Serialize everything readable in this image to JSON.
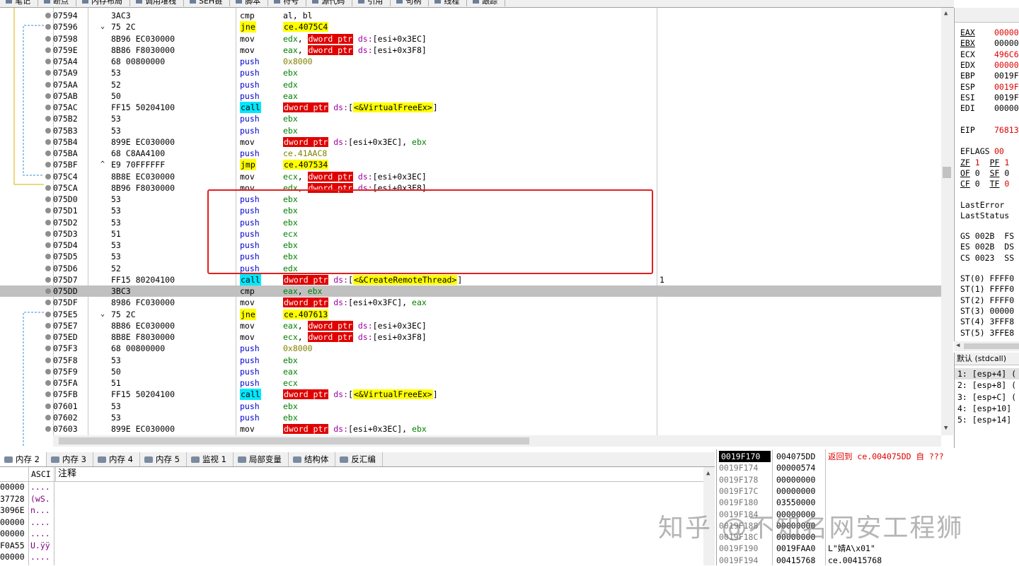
{
  "top_tabs": [
    "笔记",
    "断点",
    "内存布局",
    "调用堆栈",
    "SEH链",
    "脚本",
    "符号",
    "源代码",
    "引用",
    "句柄",
    "线程",
    "跟踪"
  ],
  "disasm": {
    "rows": [
      {
        "addr": "07594",
        "jm": "",
        "bytes": "3AC3",
        "mn": "cmp",
        "kind": "plain",
        "ops": [
          {
            "t": "al, bl",
            "k": "txt"
          }
        ],
        "cmt": ""
      },
      {
        "addr": "07596",
        "jm": "⌄",
        "bytes": "75 2C",
        "mn": "jne",
        "kind": "jmp",
        "ops": [
          {
            "t": "ce.4075C4",
            "k": "lbl"
          }
        ],
        "cmt": ""
      },
      {
        "addr": "07598",
        "jm": "",
        "bytes": "8B96 EC030000",
        "mn": "mov",
        "kind": "plain",
        "ops": [
          {
            "t": "edx",
            "k": "reg"
          },
          {
            "t": ", ",
            "k": "txt"
          },
          {
            "t": "dword ptr",
            "k": "ptr"
          },
          {
            "t": " ds:",
            "k": "seg"
          },
          {
            "t": "[esi+0x3EC]",
            "k": "txt"
          }
        ],
        "cmt": ""
      },
      {
        "addr": "0759E",
        "jm": "",
        "bytes": "8B86 F8030000",
        "mn": "mov",
        "kind": "plain",
        "ops": [
          {
            "t": "eax",
            "k": "reg"
          },
          {
            "t": ", ",
            "k": "txt"
          },
          {
            "t": "dword ptr",
            "k": "ptr"
          },
          {
            "t": " ds:",
            "k": "seg"
          },
          {
            "t": "[esi+0x3F8]",
            "k": "txt"
          }
        ],
        "cmt": ""
      },
      {
        "addr": "075A4",
        "jm": "",
        "bytes": "68 00800000",
        "mn": "push",
        "kind": "push",
        "ops": [
          {
            "t": "0x8000",
            "k": "imm"
          }
        ],
        "cmt": ""
      },
      {
        "addr": "075A9",
        "jm": "",
        "bytes": "53",
        "mn": "push",
        "kind": "push",
        "ops": [
          {
            "t": "ebx",
            "k": "reg"
          }
        ],
        "cmt": ""
      },
      {
        "addr": "075AA",
        "jm": "",
        "bytes": "52",
        "mn": "push",
        "kind": "push",
        "ops": [
          {
            "t": "edx",
            "k": "reg"
          }
        ],
        "cmt": ""
      },
      {
        "addr": "075AB",
        "jm": "",
        "bytes": "50",
        "mn": "push",
        "kind": "push",
        "ops": [
          {
            "t": "eax",
            "k": "reg"
          }
        ],
        "cmt": ""
      },
      {
        "addr": "075AC",
        "jm": "",
        "bytes": "FF15 50204100",
        "mn": "call",
        "kind": "call",
        "ops": [
          {
            "t": "dword ptr",
            "k": "ptr"
          },
          {
            "t": " ds:",
            "k": "seg"
          },
          {
            "t": "[",
            "k": "txt"
          },
          {
            "t": "<&VirtualFreeEx>",
            "k": "api"
          },
          {
            "t": "]",
            "k": "txt"
          }
        ],
        "cmt": ""
      },
      {
        "addr": "075B2",
        "jm": "",
        "bytes": "53",
        "mn": "push",
        "kind": "push",
        "ops": [
          {
            "t": "ebx",
            "k": "reg"
          }
        ],
        "cmt": ""
      },
      {
        "addr": "075B3",
        "jm": "",
        "bytes": "53",
        "mn": "push",
        "kind": "push",
        "ops": [
          {
            "t": "ebx",
            "k": "reg"
          }
        ],
        "cmt": ""
      },
      {
        "addr": "075B4",
        "jm": "",
        "bytes": "899E EC030000",
        "mn": "mov",
        "kind": "plain",
        "ops": [
          {
            "t": "dword ptr",
            "k": "ptr"
          },
          {
            "t": " ds:",
            "k": "seg"
          },
          {
            "t": "[esi+0x3EC], ",
            "k": "txt"
          },
          {
            "t": "ebx",
            "k": "reg"
          }
        ],
        "cmt": ""
      },
      {
        "addr": "075BA",
        "jm": "",
        "bytes": "68 C8AA4100",
        "mn": "push",
        "kind": "push",
        "ops": [
          {
            "t": "ce.41AAC8",
            "k": "imm"
          }
        ],
        "cmt": ""
      },
      {
        "addr": "075BF",
        "jm": "^",
        "bytes": "E9 70FFFFFF",
        "mn": "jmp",
        "kind": "jmp",
        "ops": [
          {
            "t": "ce.407534",
            "k": "lbl"
          }
        ],
        "cmt": ""
      },
      {
        "addr": "075C4",
        "jm": "",
        "bytes": "8B8E EC030000",
        "mn": "mov",
        "kind": "plain",
        "ops": [
          {
            "t": "ecx",
            "k": "reg"
          },
          {
            "t": ", ",
            "k": "txt"
          },
          {
            "t": "dword ptr",
            "k": "ptr"
          },
          {
            "t": " ds:",
            "k": "seg"
          },
          {
            "t": "[esi+0x3EC]",
            "k": "txt"
          }
        ],
        "cmt": ""
      },
      {
        "addr": "075CA",
        "jm": "",
        "bytes": "8B96 F8030000",
        "mn": "mov",
        "kind": "plain",
        "ops": [
          {
            "t": "edx",
            "k": "reg"
          },
          {
            "t": ", ",
            "k": "txt"
          },
          {
            "t": "dword ptr",
            "k": "ptr"
          },
          {
            "t": " ds:",
            "k": "seg"
          },
          {
            "t": "[esi+0x3F8]",
            "k": "txt"
          }
        ],
        "cmt": ""
      },
      {
        "addr": "075D0",
        "jm": "",
        "bytes": "53",
        "mn": "push",
        "kind": "push",
        "ops": [
          {
            "t": "ebx",
            "k": "reg"
          }
        ],
        "cmt": ""
      },
      {
        "addr": "075D1",
        "jm": "",
        "bytes": "53",
        "mn": "push",
        "kind": "push",
        "ops": [
          {
            "t": "ebx",
            "k": "reg"
          }
        ],
        "cmt": ""
      },
      {
        "addr": "075D2",
        "jm": "",
        "bytes": "53",
        "mn": "push",
        "kind": "push",
        "ops": [
          {
            "t": "ebx",
            "k": "reg"
          }
        ],
        "cmt": ""
      },
      {
        "addr": "075D3",
        "jm": "",
        "bytes": "51",
        "mn": "push",
        "kind": "push",
        "ops": [
          {
            "t": "ecx",
            "k": "reg"
          }
        ],
        "cmt": ""
      },
      {
        "addr": "075D4",
        "jm": "",
        "bytes": "53",
        "mn": "push",
        "kind": "push",
        "ops": [
          {
            "t": "ebx",
            "k": "reg"
          }
        ],
        "cmt": ""
      },
      {
        "addr": "075D5",
        "jm": "",
        "bytes": "53",
        "mn": "push",
        "kind": "push",
        "ops": [
          {
            "t": "ebx",
            "k": "reg"
          }
        ],
        "cmt": ""
      },
      {
        "addr": "075D6",
        "jm": "",
        "bytes": "52",
        "mn": "push",
        "kind": "push",
        "ops": [
          {
            "t": "edx",
            "k": "reg"
          }
        ],
        "cmt": ""
      },
      {
        "addr": "075D7",
        "jm": "",
        "bytes": "FF15 80204100",
        "mn": "call",
        "kind": "call",
        "ops": [
          {
            "t": "dword ptr",
            "k": "ptr"
          },
          {
            "t": " ds:",
            "k": "seg"
          },
          {
            "t": "[",
            "k": "txt"
          },
          {
            "t": "<&CreateRemoteThread>",
            "k": "api"
          },
          {
            "t": "]",
            "k": "txt"
          }
        ],
        "cmt": "1"
      },
      {
        "addr": "075DD",
        "jm": "",
        "bytes": "3BC3",
        "mn": "cmp",
        "kind": "plain",
        "ops": [
          {
            "t": "eax",
            "k": "reg"
          },
          {
            "t": ", ",
            "k": "txt"
          },
          {
            "t": "ebx",
            "k": "reg"
          }
        ],
        "cmt": "",
        "sel": true
      },
      {
        "addr": "075DF",
        "jm": "",
        "bytes": "8986 FC030000",
        "mn": "mov",
        "kind": "plain",
        "ops": [
          {
            "t": "dword ptr",
            "k": "ptr"
          },
          {
            "t": " ds:",
            "k": "seg"
          },
          {
            "t": "[esi+0x3FC], ",
            "k": "txt"
          },
          {
            "t": "eax",
            "k": "reg"
          }
        ],
        "cmt": ""
      },
      {
        "addr": "075E5",
        "jm": "⌄",
        "bytes": "75 2C",
        "mn": "jne",
        "kind": "jmp",
        "ops": [
          {
            "t": "ce.407613",
            "k": "lbl"
          }
        ],
        "cmt": ""
      },
      {
        "addr": "075E7",
        "jm": "",
        "bytes": "8B86 EC030000",
        "mn": "mov",
        "kind": "plain",
        "ops": [
          {
            "t": "eax",
            "k": "reg"
          },
          {
            "t": ", ",
            "k": "txt"
          },
          {
            "t": "dword ptr",
            "k": "ptr"
          },
          {
            "t": " ds:",
            "k": "seg"
          },
          {
            "t": "[esi+0x3EC]",
            "k": "txt"
          }
        ],
        "cmt": ""
      },
      {
        "addr": "075ED",
        "jm": "",
        "bytes": "8B8E F8030000",
        "mn": "mov",
        "kind": "plain",
        "ops": [
          {
            "t": "ecx",
            "k": "reg"
          },
          {
            "t": ", ",
            "k": "txt"
          },
          {
            "t": "dword ptr",
            "k": "ptr"
          },
          {
            "t": " ds:",
            "k": "seg"
          },
          {
            "t": "[esi+0x3F8]",
            "k": "txt"
          }
        ],
        "cmt": ""
      },
      {
        "addr": "075F3",
        "jm": "",
        "bytes": "68 00800000",
        "mn": "push",
        "kind": "push",
        "ops": [
          {
            "t": "0x8000",
            "k": "imm"
          }
        ],
        "cmt": ""
      },
      {
        "addr": "075F8",
        "jm": "",
        "bytes": "53",
        "mn": "push",
        "kind": "push",
        "ops": [
          {
            "t": "ebx",
            "k": "reg"
          }
        ],
        "cmt": ""
      },
      {
        "addr": "075F9",
        "jm": "",
        "bytes": "50",
        "mn": "push",
        "kind": "push",
        "ops": [
          {
            "t": "eax",
            "k": "reg"
          }
        ],
        "cmt": ""
      },
      {
        "addr": "075FA",
        "jm": "",
        "bytes": "51",
        "mn": "push",
        "kind": "push",
        "ops": [
          {
            "t": "ecx",
            "k": "reg"
          }
        ],
        "cmt": ""
      },
      {
        "addr": "075FB",
        "jm": "",
        "bytes": "FF15 50204100",
        "mn": "call",
        "kind": "call",
        "ops": [
          {
            "t": "dword ptr",
            "k": "ptr"
          },
          {
            "t": " ds:",
            "k": "seg"
          },
          {
            "t": "[",
            "k": "txt"
          },
          {
            "t": "<&VirtualFreeEx>",
            "k": "api"
          },
          {
            "t": "]",
            "k": "txt"
          }
        ],
        "cmt": ""
      },
      {
        "addr": "07601",
        "jm": "",
        "bytes": "53",
        "mn": "push",
        "kind": "push",
        "ops": [
          {
            "t": "ebx",
            "k": "reg"
          }
        ],
        "cmt": ""
      },
      {
        "addr": "07602",
        "jm": "",
        "bytes": "53",
        "mn": "push",
        "kind": "push",
        "ops": [
          {
            "t": "ebx",
            "k": "reg"
          }
        ],
        "cmt": ""
      },
      {
        "addr": "07603",
        "jm": "",
        "bytes": "899E EC030000",
        "mn": "mov",
        "kind": "plain",
        "ops": [
          {
            "t": "dword ptr",
            "k": "ptr"
          },
          {
            "t": " ds:",
            "k": "seg"
          },
          {
            "t": "[esi+0x3EC], ",
            "k": "txt"
          },
          {
            "t": "ebx",
            "k": "reg"
          }
        ],
        "cmt": ""
      }
    ]
  },
  "registers": {
    "rows": [
      {
        "n": "EAX",
        "v": "00000",
        "u": true,
        "red": true
      },
      {
        "n": "EBX",
        "v": "00000",
        "u": true,
        "red": false
      },
      {
        "n": "ECX",
        "v": "496C6",
        "u": false,
        "red": true
      },
      {
        "n": "EDX",
        "v": "00000",
        "u": false,
        "red": true
      },
      {
        "n": "EBP",
        "v": "0019F",
        "u": false,
        "red": false
      },
      {
        "n": "ESP",
        "v": "0019F",
        "u": false,
        "red": true
      },
      {
        "n": "ESI",
        "v": "0019F",
        "u": false,
        "red": false
      },
      {
        "n": "EDI",
        "v": "00000",
        "u": false,
        "red": false
      },
      {
        "n": "",
        "v": "",
        "u": false,
        "red": false
      },
      {
        "n": "EIP",
        "v": "76813",
        "u": false,
        "red": true
      },
      {
        "n": "",
        "v": "",
        "u": false,
        "red": false
      },
      {
        "n": "EFLAGS",
        "v": "00",
        "u": false,
        "red": true
      }
    ],
    "flags": [
      {
        "a": "ZF",
        "av": "1",
        "ared": true,
        "b": "PF",
        "bv": "1",
        "bred": true
      },
      {
        "a": "OF",
        "av": "0",
        "ared": false,
        "b": "SF",
        "bv": "0",
        "bred": false
      },
      {
        "a": "CF",
        "av": "0",
        "ared": false,
        "b": "TF",
        "bv": "0",
        "bred": true
      }
    ],
    "last_error": "LastError",
    "last_status": "LastStatus",
    "segs": [
      "GS 002B  FS",
      "ES 002B  DS",
      "CS 0023  SS"
    ],
    "st": [
      "ST(0) FFFF0",
      "ST(1) FFFF0",
      "ST(2) FFFF0",
      "ST(3) 00000",
      "ST(4) 3FFF8",
      "ST(5) 3FFE8"
    ]
  },
  "args": {
    "header": "默认 (stdcall)",
    "rows": [
      "1: [esp+4] (",
      "2: [esp+8] (",
      "3: [esp+C] (",
      "4: [esp+10]",
      "5: [esp+14]"
    ]
  },
  "bottom_tabs": [
    {
      "label": "内存 2",
      "active": true
    },
    {
      "label": "内存 3",
      "active": false
    },
    {
      "label": "内存 4",
      "active": false
    },
    {
      "label": "内存 5",
      "active": false
    },
    {
      "label": "监视 1",
      "active": false
    },
    {
      "label": "局部变量",
      "active": false
    },
    {
      "label": "结构体",
      "active": false
    },
    {
      "label": "反汇编",
      "active": false
    }
  ],
  "dump": {
    "col_ascii": "ASCI",
    "col_comment": "注释",
    "rows": [
      {
        "h": "00000",
        "a": "...."
      },
      {
        "h": "37728",
        "a": "(wS."
      },
      {
        "h": "3096E",
        "a": "n..."
      },
      {
        "h": "00000",
        "a": "...."
      },
      {
        "h": "00000",
        "a": "...."
      },
      {
        "h": "F0A55",
        "a": "U.ÿÿ"
      },
      {
        "h": "00000",
        "a": "...."
      }
    ]
  },
  "stack": {
    "rows": [
      {
        "a": "0019F170",
        "v": "004075DD",
        "c": "返回到 ce.004075DD 自 ???",
        "red": true,
        "sel": true
      },
      {
        "a": "0019F174",
        "v": "00000574",
        "c": "",
        "red": false
      },
      {
        "a": "0019F178",
        "v": "00000000",
        "c": "",
        "red": false
      },
      {
        "a": "0019F17C",
        "v": "00000000",
        "c": "",
        "red": false
      },
      {
        "a": "0019F180",
        "v": "03550000",
        "c": "",
        "red": false
      },
      {
        "a": "0019F184",
        "v": "00000000",
        "c": "",
        "red": false
      },
      {
        "a": "0019F188",
        "v": "00000000",
        "c": "",
        "red": false
      },
      {
        "a": "0019F18C",
        "v": "00000000",
        "c": "",
        "red": false
      },
      {
        "a": "0019F190",
        "v": "0019FAA0",
        "c": "L\"婧A\\x01\"",
        "red": false
      },
      {
        "a": "0019F194",
        "v": "00415768",
        "c": "ce.00415768",
        "red": false
      }
    ]
  },
  "watermark": "知乎 @不知名网安工程狮"
}
